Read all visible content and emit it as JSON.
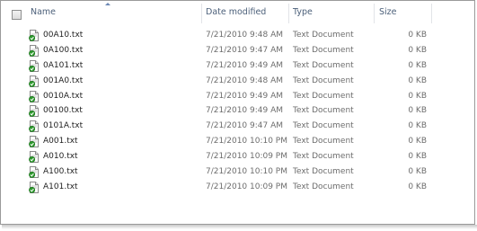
{
  "columns": {
    "name": "Name",
    "date_modified": "Date modified",
    "type": "Type",
    "size": "Size"
  },
  "files": [
    {
      "name": "00A10.txt",
      "date": "7/21/2010 9:48 AM",
      "type": "Text Document",
      "size": "0 KB"
    },
    {
      "name": "0A100.txt",
      "date": "7/21/2010 9:47 AM",
      "type": "Text Document",
      "size": "0 KB"
    },
    {
      "name": "0A101.txt",
      "date": "7/21/2010 9:49 AM",
      "type": "Text Document",
      "size": "0 KB"
    },
    {
      "name": "001A0.txt",
      "date": "7/21/2010 9:48 AM",
      "type": "Text Document",
      "size": "0 KB"
    },
    {
      "name": "0010A.txt",
      "date": "7/21/2010 9:49 AM",
      "type": "Text Document",
      "size": "0 KB"
    },
    {
      "name": "00100.txt",
      "date": "7/21/2010 9:49 AM",
      "type": "Text Document",
      "size": "0 KB"
    },
    {
      "name": "0101A.txt",
      "date": "7/21/2010 9:47 AM",
      "type": "Text Document",
      "size": "0 KB"
    },
    {
      "name": "A001.txt",
      "date": "7/21/2010 10:10 PM",
      "type": "Text Document",
      "size": "0 KB"
    },
    {
      "name": "A010.txt",
      "date": "7/21/2010 10:09 PM",
      "type": "Text Document",
      "size": "0 KB"
    },
    {
      "name": "A100.txt",
      "date": "7/21/2010 10:10 PM",
      "type": "Text Document",
      "size": "0 KB"
    },
    {
      "name": "A101.txt",
      "date": "7/21/2010 10:09 PM",
      "type": "Text Document",
      "size": "0 KB"
    }
  ],
  "file_icon": "text-file-with-green-check-icon",
  "colors": {
    "header_text": "#4c607a",
    "name_text": "#1e1e1e",
    "detail_text": "#6d6d6d",
    "check_green": "#2e9a2e"
  }
}
